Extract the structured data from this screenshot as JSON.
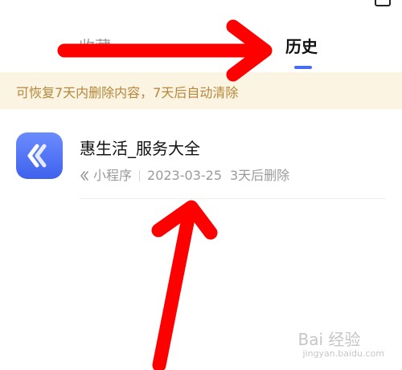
{
  "header": {
    "title": "",
    "icon": "edit-icon"
  },
  "tabs": [
    {
      "label": "收藏",
      "active": false
    },
    {
      "label": "历史",
      "active": true
    }
  ],
  "accent_color": "#4a6cf0",
  "notice": {
    "text": "可恢复7天内删除内容，7天后自动清除"
  },
  "history_item": {
    "name": "惠生活_服务大全",
    "type_label": "小程序",
    "type_icon": "mini-program-icon",
    "date": "2023-03-25",
    "delete_note": "3天后删除"
  },
  "watermark": {
    "text": "Bai 经验",
    "sub": "jingyan.baidu.com"
  }
}
